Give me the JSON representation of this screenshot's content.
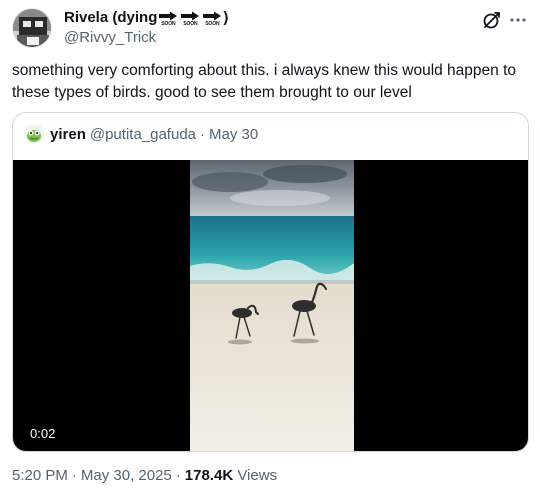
{
  "author": {
    "display_name": "Rivela (dying",
    "arrow_badges": [
      "SOON",
      "SOON",
      "SOON"
    ],
    "display_name_suffix": ")",
    "handle": "@Rivvy_Trick"
  },
  "header_icons": [
    "grok-icon",
    "more-icon"
  ],
  "tweet_text": "something very comforting about this. i always knew this would happen to these types of birds. good to see them brought to our level",
  "quoted": {
    "name": "yiren",
    "handle": "@putita_gafuda",
    "separator": "·",
    "date": "May 30",
    "video_duration": "0:02"
  },
  "meta": {
    "time": "5:20 PM",
    "separator1": "·",
    "date": "May 30, 2025",
    "separator2": "·",
    "views_count": "178.4K",
    "views_label": "Views"
  },
  "colors": {
    "text_primary": "#0f1419",
    "text_secondary": "#536471",
    "border": "#cfd9de",
    "media_background": "#000000"
  }
}
